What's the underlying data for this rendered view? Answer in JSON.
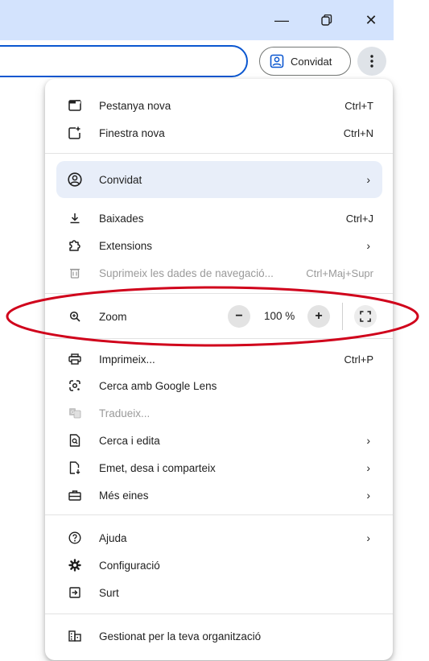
{
  "window": {
    "minimize_label": "—",
    "close_label": "✕"
  },
  "toolbar": {
    "profile_chip_label": "Convidat",
    "menu_button_label": "⋮"
  },
  "menu": {
    "new_tab": {
      "label": "Pestanya nova",
      "shortcut": "Ctrl+T"
    },
    "new_window": {
      "label": "Finestra nova",
      "shortcut": "Ctrl+N"
    },
    "profile": {
      "label": "Convidat"
    },
    "downloads": {
      "label": "Baixades",
      "shortcut": "Ctrl+J"
    },
    "extensions": {
      "label": "Extensions"
    },
    "clear_data": {
      "label": "Suprimeix les dades de navegació...",
      "shortcut": "Ctrl+Maj+Supr"
    },
    "zoom": {
      "label": "Zoom",
      "value": "100 %",
      "minus": "−",
      "plus": "+"
    },
    "print": {
      "label": "Imprimeix...",
      "shortcut": "Ctrl+P"
    },
    "google_lens": {
      "label": "Cerca amb Google Lens"
    },
    "translate": {
      "label": "Tradueix..."
    },
    "find_edit": {
      "label": "Cerca i edita"
    },
    "cast_save_share": {
      "label": "Emet, desa i comparteix"
    },
    "more_tools": {
      "label": "Més eines"
    },
    "help": {
      "label": "Ajuda"
    },
    "settings": {
      "label": "Configuració"
    },
    "exit": {
      "label": "Surt"
    },
    "managed": {
      "label": "Gestionat per la teva organització"
    },
    "chevron": "›"
  },
  "annotation": {
    "color": "#d0021b"
  },
  "colors": {
    "titlebar": "#d3e3fd",
    "accent": "#0b57d0"
  }
}
